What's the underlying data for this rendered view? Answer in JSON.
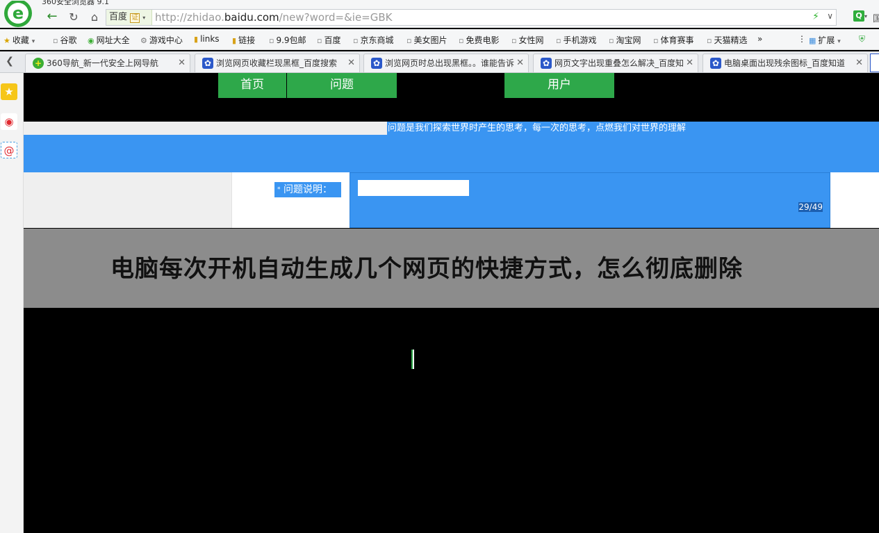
{
  "browser": {
    "window_title": "360安全浏览器 9.1",
    "address": {
      "site_name": "百度",
      "site_verified": "证",
      "url_prefix": "http://zhidao.",
      "url_domain": "baidu.com",
      "url_suffix": "/new?word=&ie=GBK"
    },
    "extra_label": "国"
  },
  "bookmarks": [
    {
      "label": "收藏",
      "icon": "star-icon"
    },
    {
      "label": "谷歌",
      "icon": "page-icon"
    },
    {
      "label": "网址大全",
      "icon": "360-icon"
    },
    {
      "label": "游戏中心",
      "icon": "gamepad-icon"
    },
    {
      "label": "links",
      "icon": "folder-icon"
    },
    {
      "label": "链接",
      "icon": "folder-icon"
    },
    {
      "label": "9.9包邮",
      "icon": "page-icon"
    },
    {
      "label": "百度",
      "icon": "page-icon"
    },
    {
      "label": "京东商城",
      "icon": "page-icon"
    },
    {
      "label": "美女图片",
      "icon": "page-icon"
    },
    {
      "label": "免费电影",
      "icon": "page-icon"
    },
    {
      "label": "女性网",
      "icon": "page-icon"
    },
    {
      "label": "手机游戏",
      "icon": "page-icon"
    },
    {
      "label": "淘宝网",
      "icon": "page-icon"
    },
    {
      "label": "体育赛事",
      "icon": "page-icon"
    },
    {
      "label": "天猫精选",
      "icon": "page-icon"
    },
    {
      "label": "»",
      "icon": "more-icon"
    },
    {
      "label": "扩展",
      "icon": "extensions-icon"
    }
  ],
  "tabs": [
    {
      "label": "360导航_新一代安全上网导航",
      "icon": "360-icon"
    },
    {
      "label": "浏览网页收藏栏现黑框_百度搜索",
      "icon": "baidu-paw-icon"
    },
    {
      "label": "浏览网页时总出现黑框。。谁能告诉",
      "icon": "baidu-paw-icon"
    },
    {
      "label": "网页文字出现重叠怎么解决_百度知",
      "icon": "baidu-paw-icon"
    },
    {
      "label": "电脑桌面出现残余图标_百度知道",
      "icon": "baidu-paw-icon"
    }
  ],
  "page": {
    "nav": {
      "home": "首页",
      "question": "问题",
      "user": "用户"
    },
    "slogan": "问题是我们探索世界时产生的思考，每一次的思考，点燃我们对世界的理解",
    "description_label": "问题说明：",
    "required_mark": "*",
    "counter": "29/49",
    "question_title": "电脑每次开机自动生成几个网页的快捷方式，怎么彻底删除"
  },
  "colors": {
    "nav_green": "#2ea84a",
    "selection_blue": "#3a95f2",
    "overlay_gray": "#8c8c8c"
  }
}
